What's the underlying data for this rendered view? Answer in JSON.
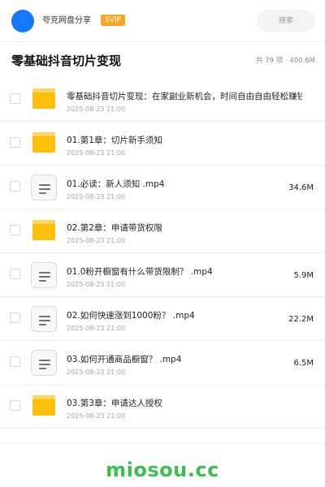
{
  "topbar": {
    "user_name": "夸克网盘分享",
    "badge": "SVIP",
    "search_placeholder": "搜索",
    "avatar_color": "#1677ff"
  },
  "folder": {
    "title": "零基础抖音切片变现",
    "stats": "共 79 项 · 400.6M"
  },
  "files": [
    {
      "type": "folder",
      "icon": "folder-icon",
      "name": "零基础抖音切片变现：在家副业新机会，时间自由自由轻松赚钱",
      "date": "2025-08-23 21:00",
      "size": ""
    },
    {
      "type": "folder",
      "icon": "folder-icon",
      "name": "01.第1章：切片新手须知",
      "date": "2025-08-23 21:00",
      "size": ""
    },
    {
      "type": "video",
      "icon": "document-icon",
      "name": "01.必读：新人须知 .mp4",
      "date": "2025-08-23 21:00",
      "size": "34.6M"
    },
    {
      "type": "folder",
      "icon": "folder-icon",
      "name": "02.第2章：申请带货权限",
      "date": "2025-08-23 21:00",
      "size": ""
    },
    {
      "type": "video",
      "icon": "document-icon",
      "name": "01.0粉开橱窗有什么带货限制？ .mp4",
      "date": "2025-08-23 21:00",
      "size": "5.9M"
    },
    {
      "type": "video",
      "icon": "document-icon",
      "name": "02.如何快速涨到1000粉？ .mp4",
      "date": "2025-08-23 21:00",
      "size": "22.2M"
    },
    {
      "type": "video",
      "icon": "document-icon",
      "name": "03.如何开通商品橱窗？ .mp4",
      "date": "2025-08-23 21:00",
      "size": "6.5M"
    },
    {
      "type": "folder",
      "icon": "folder-icon",
      "name": "03.第3章：申请达人授权",
      "date": "2025-08-23 21:00",
      "size": ""
    }
  ],
  "footer": {
    "brand": "miosou.cc",
    "brand_color": "#3cbf4f"
  }
}
